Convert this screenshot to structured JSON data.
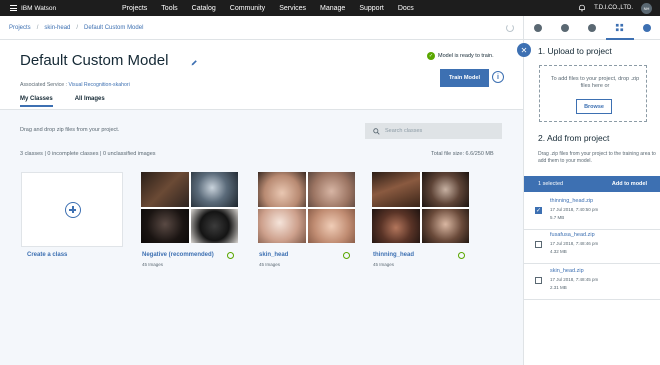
{
  "nav": {
    "brand": "IBM Watson",
    "items": [
      "Projects",
      "Tools",
      "Catalog",
      "Community",
      "Services",
      "Manage",
      "Support",
      "Docs"
    ],
    "company": "T.D.I.CO.,LTD.",
    "avatar_initials": "NH"
  },
  "breadcrumb": [
    "Projects",
    "skin-head",
    "Default Custom Model"
  ],
  "header": {
    "title": "Default Custom Model",
    "assoc_label": "Associated Service :",
    "assoc_value": "Visual Recognition-skahori",
    "ready_text": "Model is ready to train.",
    "train_button": "Train Model",
    "tabs": [
      "My Classes",
      "All Images"
    ]
  },
  "content": {
    "drag_text": "Drag and drop zip files from your project.",
    "search_placeholder": "Search classes",
    "counts_text": "3 classes | 0 incomplete classes | 0 unclassified images",
    "total_size": "Total file size: 6.6/250 MB",
    "create_label": "Create a class",
    "classes": [
      {
        "name": "Negative (recommended)",
        "count": "45 Images"
      },
      {
        "name": "skin_head",
        "count": "45 Images"
      },
      {
        "name": "thinning_head",
        "count": "45 Images"
      }
    ]
  },
  "panel": {
    "upload_heading": "1. Upload to project",
    "drop_text": "To add files to your project, drop .zip files here or",
    "browse_label": "Browse",
    "add_heading": "2. Add from project",
    "add_desc": "Drag .zip files from your project to the training area to add them to your model.",
    "selected_text": "1 selected",
    "add_to_model": "Add to model",
    "files": [
      {
        "name": "thinning_head.zip",
        "date": "17 Jul 2018, 7:40:50 pm",
        "size": "5.7 MB",
        "checked": true
      },
      {
        "name": "fusafusa_head.zip",
        "date": "17 Jul 2018, 7:48:46 pm",
        "size": "4.32 MB",
        "checked": false
      },
      {
        "name": "skin_head.zip",
        "date": "17 Jul 2018, 7:48:45 pm",
        "size": "2.31 MB",
        "checked": false
      }
    ]
  },
  "colors": {
    "accent": "#3d70b2",
    "success": "#5aa700",
    "nav_bg": "#1d1d1d"
  }
}
